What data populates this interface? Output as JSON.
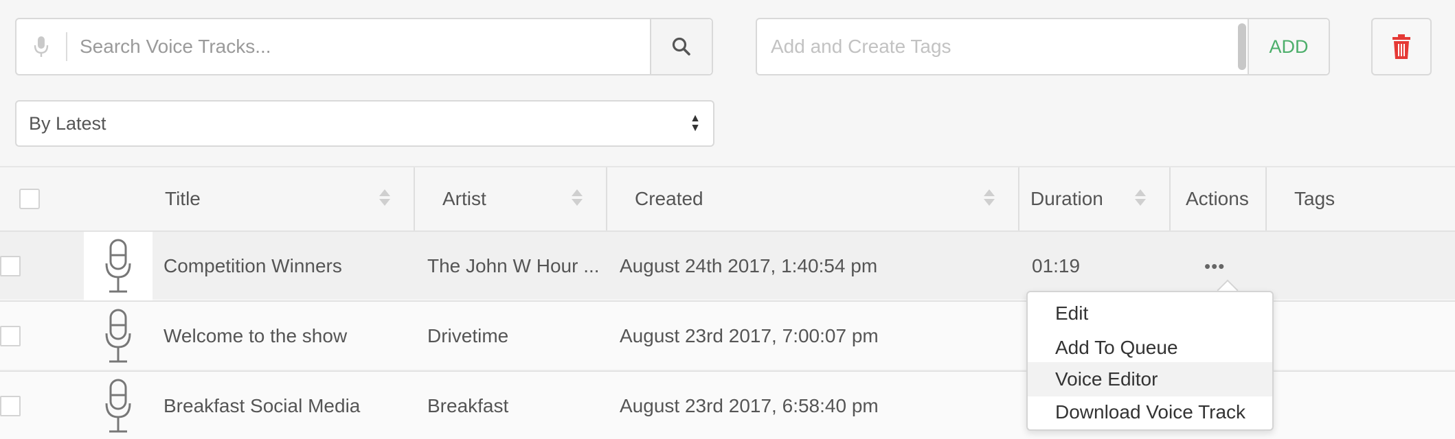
{
  "search": {
    "placeholder": "Search Voice Tracks..."
  },
  "tags_input": {
    "placeholder": "Add and Create Tags",
    "add_label": "ADD"
  },
  "sort": {
    "selected": "By Latest"
  },
  "colors": {
    "add": "#4cae6a",
    "trash": "#e53935",
    "icon": "#777777"
  },
  "table": {
    "columns": {
      "title": "Title",
      "artist": "Artist",
      "created": "Created",
      "duration": "Duration",
      "actions": "Actions",
      "tags": "Tags"
    },
    "rows": [
      {
        "title": "Competition Winners",
        "artist": "The John W Hour ...",
        "created": "August 24th 2017, 1:40:54 pm",
        "duration": "01:19",
        "actions": "•••"
      },
      {
        "title": "Welcome to the show",
        "artist": "Drivetime",
        "created": "August 23rd 2017, 7:00:07 pm",
        "duration": "",
        "actions": ""
      },
      {
        "title": "Breakfast Social Media",
        "artist": "Breakfast",
        "created": "August 23rd 2017, 6:58:40 pm",
        "duration": "",
        "actions": ""
      }
    ]
  },
  "actions_menu": {
    "items": [
      "Edit",
      "Add To Queue",
      "Voice Editor",
      "Download Voice Track"
    ],
    "highlighted": "Voice Editor"
  }
}
